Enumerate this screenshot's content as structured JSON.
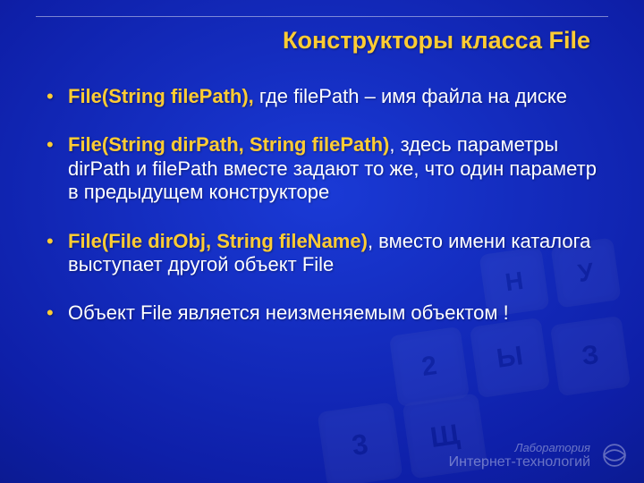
{
  "title": "Конструкторы класса File",
  "bullets": [
    {
      "emph": "File(String filePath),",
      "rest": " где filePath – имя файла на диске"
    },
    {
      "emph": "File(String dirPath, String filePath)",
      "rest": ",  здесь параметры dirPath и filePath вместе задают то же, что один параметр в предыдущем конструкторе"
    },
    {
      "emph": "File(File dirObj, String fileName)",
      "rest": ", вместо имени каталога  выступает другой объект File"
    },
    {
      "emph": "",
      "rest": "Объект File является неизменяемым объектом !"
    }
  ],
  "footer": {
    "line1": "Лаборатория",
    "line2": "Интернет-технологий"
  },
  "bgkeys": [
    "Н",
    "У",
    "2",
    "Ы",
    "3",
    "Щ",
    "З"
  ]
}
